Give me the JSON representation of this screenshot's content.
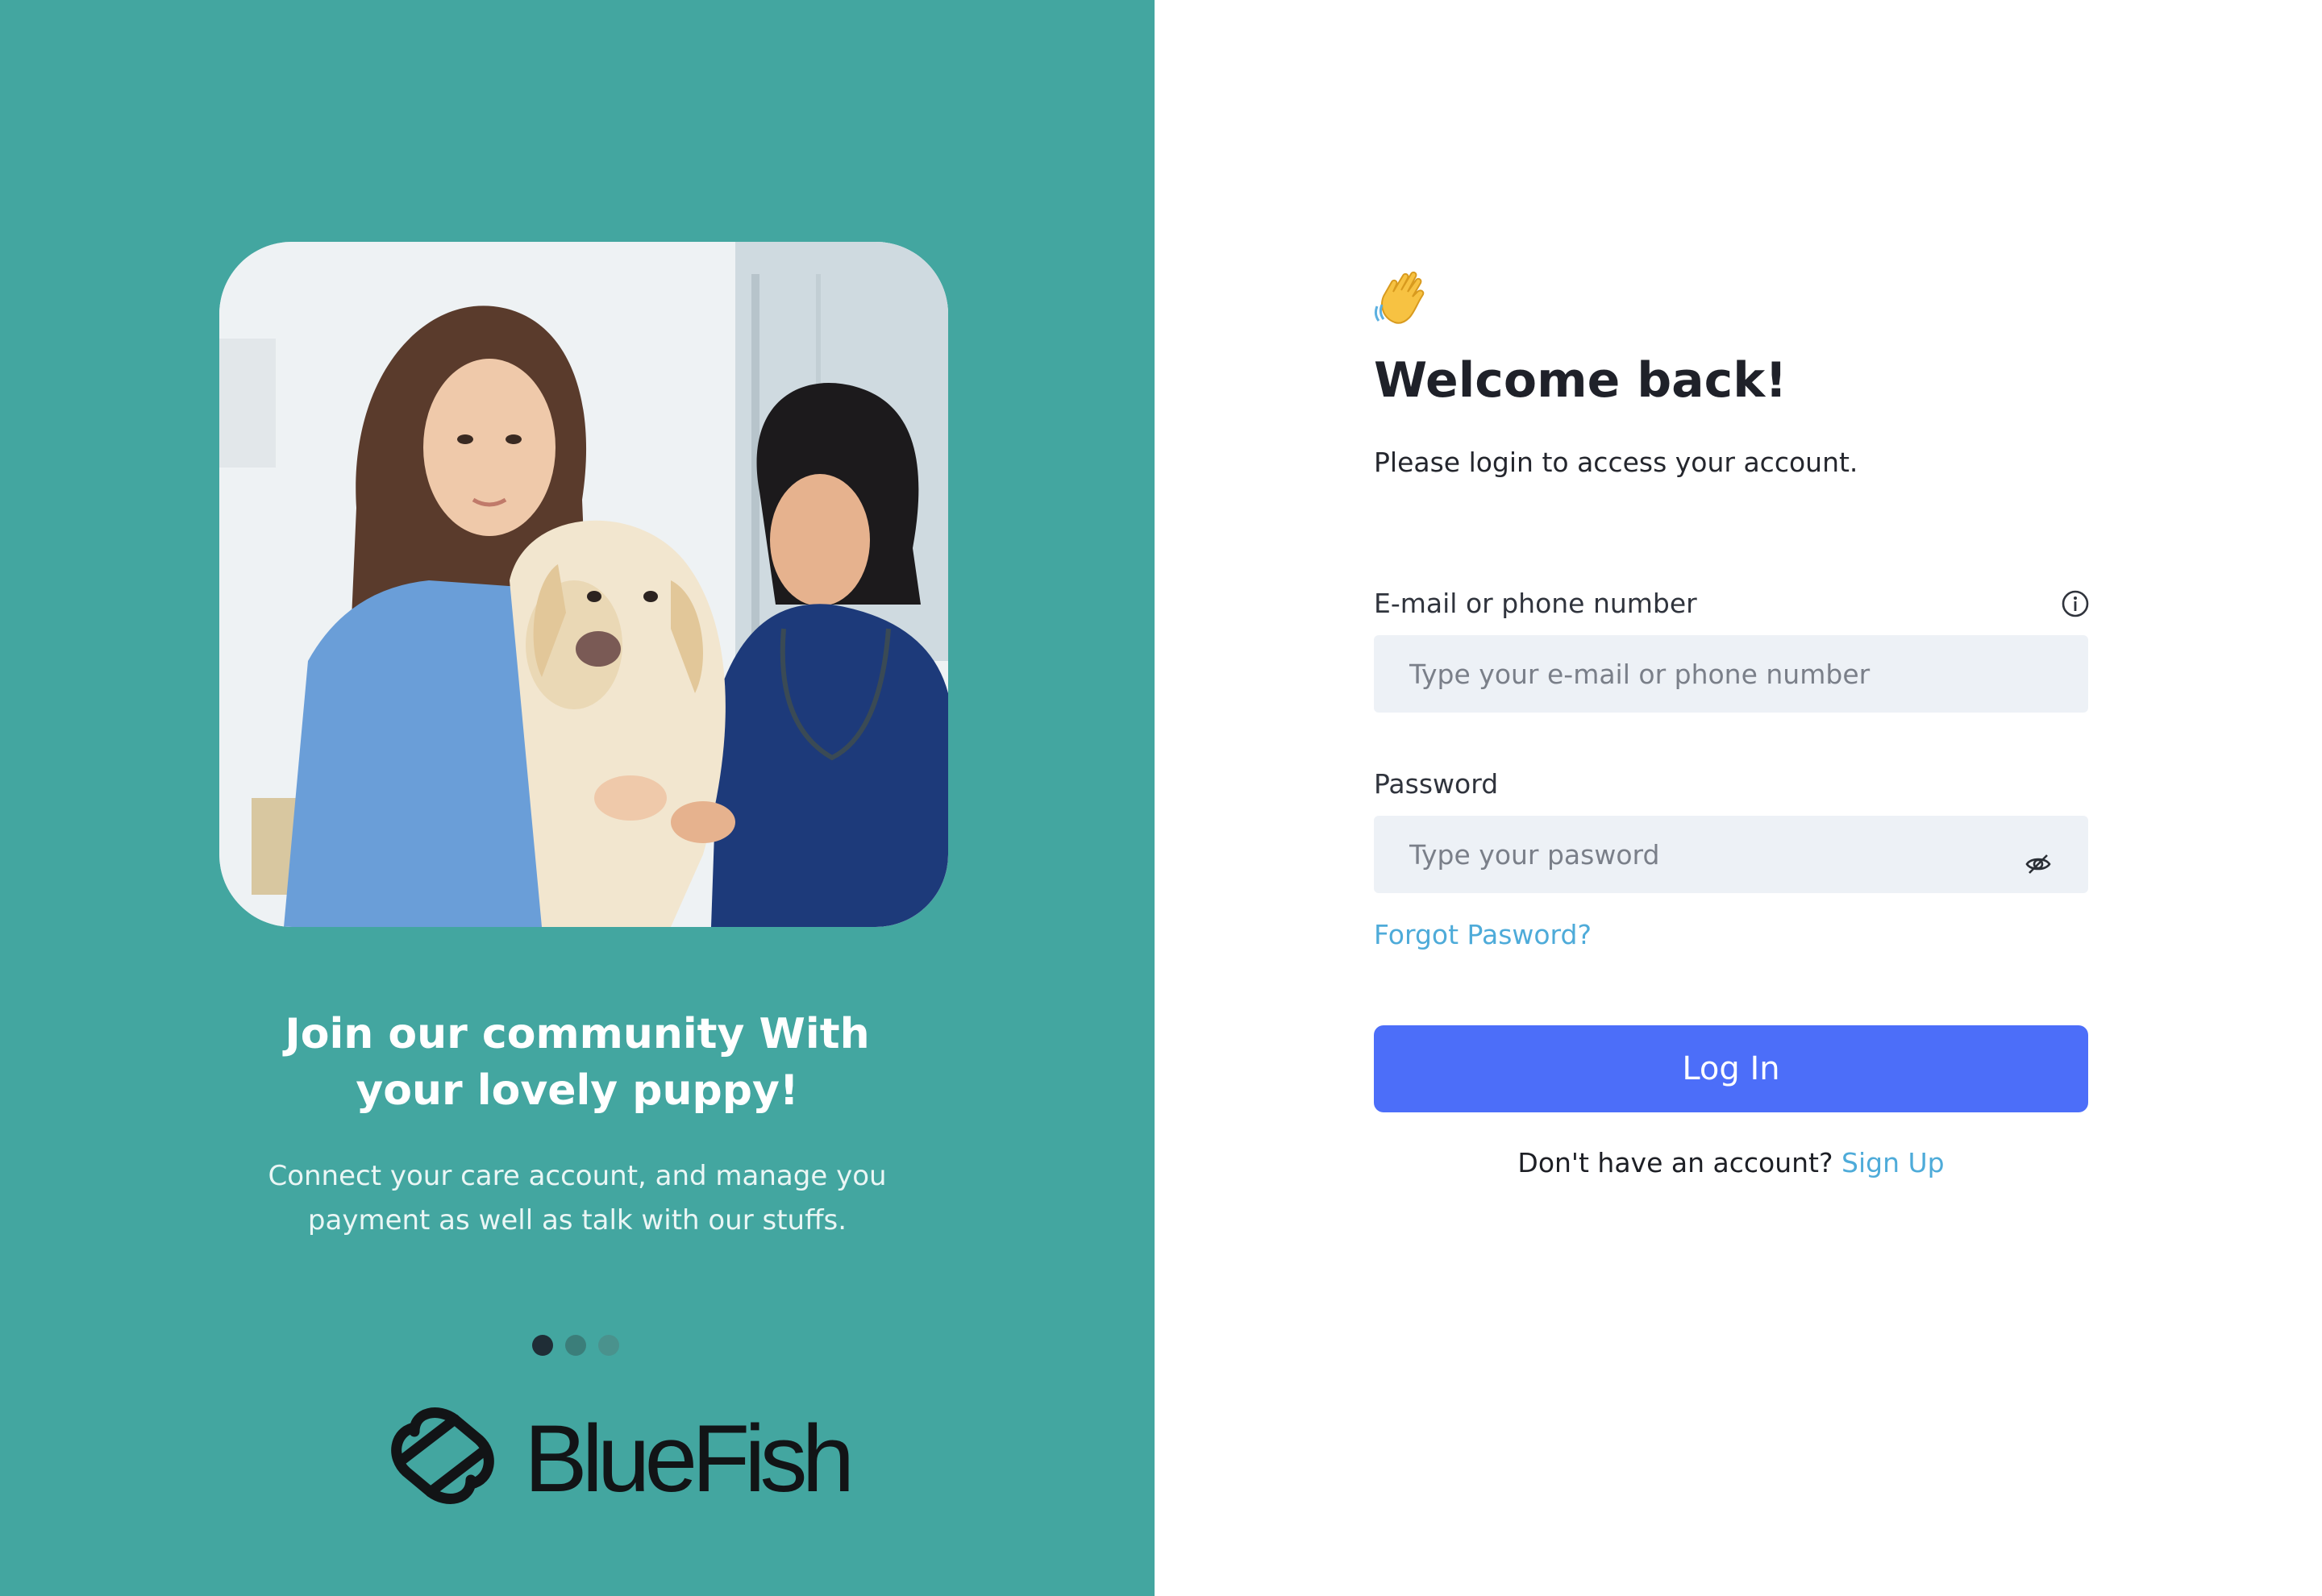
{
  "hero": {
    "photo_icon": "vets-with-dog-photo",
    "title_line1": "Join our community With",
    "title_line2": "your lovely puppy!",
    "subtitle_line1": "Connect your care account, and manage you",
    "subtitle_line2": "payment as well as talk with our stuffs.",
    "carousel": {
      "count": 3,
      "active_index": 0
    }
  },
  "brand": {
    "name": "BlueFish",
    "logo_icon": "bluefish-logo-icon"
  },
  "login": {
    "wave_icon": "waving-hand-icon",
    "title": "Welcome back!",
    "subtitle": "Please login to access your account.",
    "email_label": "E-mail or phone number",
    "email_placeholder": "Type your e-mail or phone number",
    "email_value": "",
    "info_icon": "info-icon",
    "password_label": "Password",
    "password_placeholder": "Type your pasword",
    "password_value": "",
    "eye_icon": "eye-off-icon",
    "forgot_label": "Forgot Pasword?",
    "submit_label": "Log In",
    "no_account_text": "Don't have an account?",
    "signup_label": "Sign Up"
  },
  "colors": {
    "panel_bg": "#43a6a0",
    "primary_button": "#4c6ef9",
    "link": "#4eabd9",
    "input_bg": "#edf1f6",
    "dot_active": "#1f2d36",
    "dot_inactive": "#3b7e7a"
  }
}
